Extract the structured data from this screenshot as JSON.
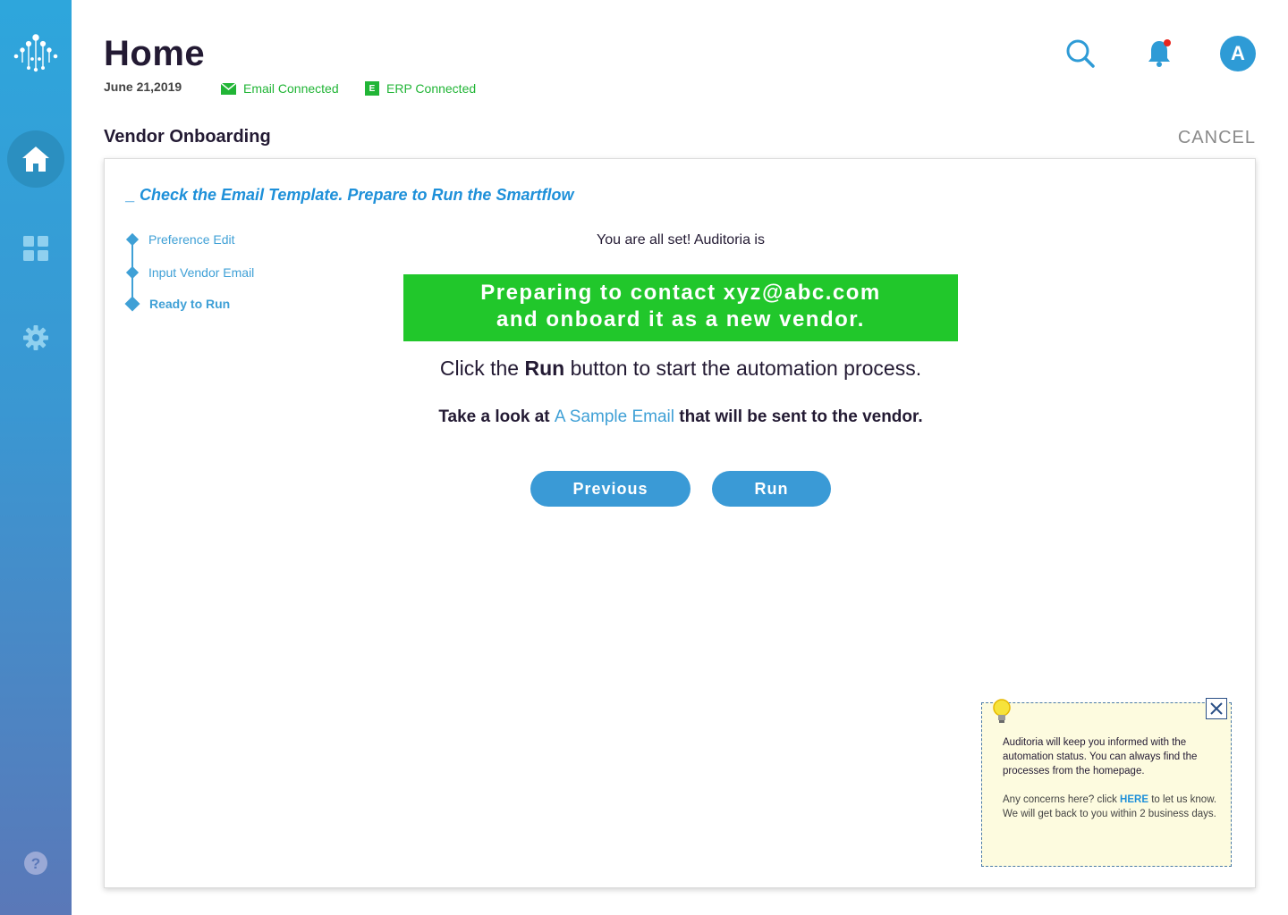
{
  "app": {
    "title": "Home",
    "date": "June 21,2019",
    "status": {
      "email_label": "Email Connected",
      "erp_label": "ERP Connected",
      "erp_badge": "E",
      "color": "#21b536"
    },
    "avatar_initial": "A"
  },
  "sidebar": {
    "items": [
      {
        "icon": "home-icon",
        "active": true
      },
      {
        "icon": "dashboard-icon",
        "active": false
      },
      {
        "icon": "gear-icon",
        "active": false
      }
    ],
    "help_icon": "question-icon"
  },
  "section": {
    "title": "Vendor Onboarding",
    "cancel_label": "CANCEL"
  },
  "card": {
    "heading": "_ Check the Email Template. Prepare to Run the Smartflow",
    "steps": [
      {
        "label": "Preference Edit"
      },
      {
        "label": "Input Vendor Email"
      },
      {
        "label": "Ready to Run",
        "active": true
      }
    ],
    "allset": "You are all set! Auditoria is",
    "banner_line1": "Preparing to contact xyz@abc.com",
    "banner_line2": "and onboard it as a new vendor.",
    "instr_pre": "Click the ",
    "instr_bold": "Run",
    "instr_post": " button to start the automation process.",
    "sample_pre": "Take a look at ",
    "sample_link": "A Sample Email",
    "sample_post": " that will be sent to the vendor.",
    "prev_label": "Previous",
    "run_label": "Run"
  },
  "tip": {
    "text1": "Auditoria will keep you informed with the automation status. You can always find the processes from the homepage.",
    "text2_pre": "Any concerns here? click ",
    "text2_link": "HERE",
    "text2_post": " to let us know. We will get back to you within 2 business days."
  },
  "colors": {
    "accent": "#3a9ad6",
    "banner": "#21c72b",
    "heading": "#1e90d9",
    "tip_bg": "#fdfbdf"
  }
}
